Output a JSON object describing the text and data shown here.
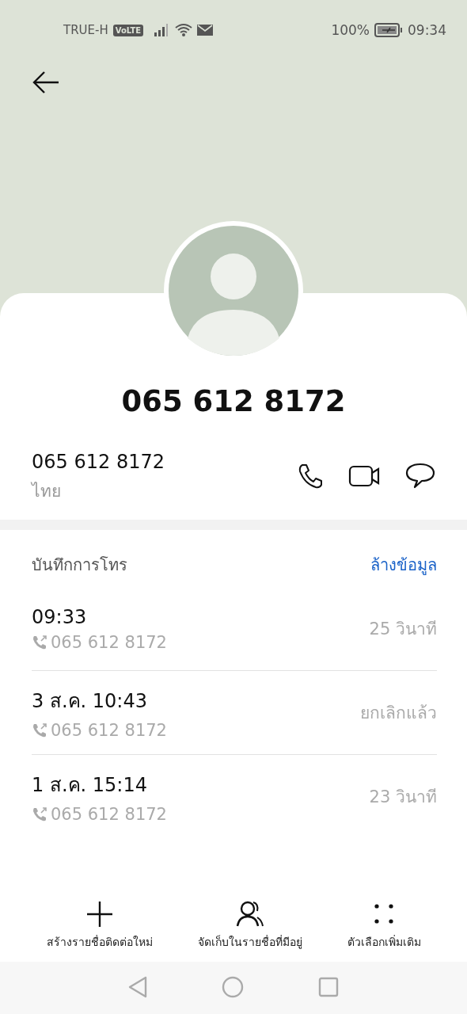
{
  "status_bar": {
    "carrier": "TRUE-H",
    "network_badge": "VoLTE",
    "battery": "100%",
    "time": "09:34"
  },
  "contact": {
    "title": "065 612 8172",
    "number": "065 612 8172",
    "region": "ไทย"
  },
  "call_log": {
    "title": "บันทึกการโทร",
    "clear_link": "ล้างข้อมูล",
    "rows": [
      {
        "time": "09:33",
        "number": "065 612 8172",
        "detail": "25 วินาที"
      },
      {
        "time": "3 ส.ค. 10:43",
        "number": "065 612 8172",
        "detail": "ยกเลิกแล้ว"
      },
      {
        "time": "1 ส.ค. 15:14",
        "number": "065 612 8172",
        "detail": "23 วินาที"
      }
    ]
  },
  "actions": [
    {
      "kind": "add",
      "label": "สร้างรายชื่อติดต่อใหม่"
    },
    {
      "kind": "contacts",
      "label": "จัดเก็บในรายชื่อที่มีอยู่"
    },
    {
      "kind": "more",
      "label": "ตัวเลือกเพิ่มเติม"
    }
  ]
}
